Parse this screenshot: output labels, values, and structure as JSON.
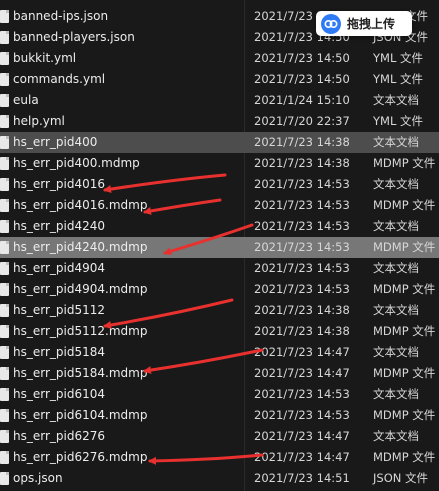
{
  "upload_button": {
    "label": "拖拽上传",
    "icon": "baidu-cloud-icon",
    "color": "#2f7bf6"
  },
  "arrow_color": "#e8312e",
  "files": [
    {
      "name": "banned-ips.json",
      "date": "2021/7/23 14:50",
      "type": "JSON 文件"
    },
    {
      "name": "banned-players.json",
      "date": "2021/7/23 14:50",
      "type": "JSON 文件"
    },
    {
      "name": "bukkit.yml",
      "date": "2021/7/23 14:50",
      "type": "YML 文件"
    },
    {
      "name": "commands.yml",
      "date": "2021/7/23 14:50",
      "type": "YML 文件"
    },
    {
      "name": "eula",
      "date": "2021/1/24 15:10",
      "type": "文本文档"
    },
    {
      "name": "help.yml",
      "date": "2021/7/20 22:37",
      "type": "YML 文件"
    },
    {
      "name": "hs_err_pid400",
      "date": "2021/7/23 14:38",
      "type": "文本文档",
      "state": "selected"
    },
    {
      "name": "hs_err_pid400.mdmp",
      "date": "2021/7/23 14:38",
      "type": "MDMP 文件"
    },
    {
      "name": "hs_err_pid4016",
      "date": "2021/7/23 14:53",
      "type": "文本文档"
    },
    {
      "name": "hs_err_pid4016.mdmp",
      "date": "2021/7/23 14:53",
      "type": "MDMP 文件"
    },
    {
      "name": "hs_err_pid4240",
      "date": "2021/7/23 14:53",
      "type": "文本文档"
    },
    {
      "name": "hs_err_pid4240.mdmp",
      "date": "2021/7/23 14:53",
      "type": "MDMP 文件",
      "state": "hover"
    },
    {
      "name": "hs_err_pid4904",
      "date": "2021/7/23 14:53",
      "type": "文本文档"
    },
    {
      "name": "hs_err_pid4904.mdmp",
      "date": "2021/7/23 14:53",
      "type": "MDMP 文件"
    },
    {
      "name": "hs_err_pid5112",
      "date": "2021/7/23 14:38",
      "type": "文本文档"
    },
    {
      "name": "hs_err_pid5112.mdmp",
      "date": "2021/7/23 14:38",
      "type": "MDMP 文件"
    },
    {
      "name": "hs_err_pid5184",
      "date": "2021/7/23 14:47",
      "type": "文本文档"
    },
    {
      "name": "hs_err_pid5184.mdmp",
      "date": "2021/7/23 14:47",
      "type": "MDMP 文件"
    },
    {
      "name": "hs_err_pid6104",
      "date": "2021/7/23 14:53",
      "type": "文本文档"
    },
    {
      "name": "hs_err_pid6104.mdmp",
      "date": "2021/7/23 14:53",
      "type": "MDMP 文件"
    },
    {
      "name": "hs_err_pid6276",
      "date": "2021/7/23 14:47",
      "type": "文本文档"
    },
    {
      "name": "hs_err_pid6276.mdmp",
      "date": "2021/7/23 14:47",
      "type": "MDMP 文件"
    },
    {
      "name": "ops.json",
      "date": "2021/7/23 14:51",
      "type": "JSON 文件"
    }
  ]
}
